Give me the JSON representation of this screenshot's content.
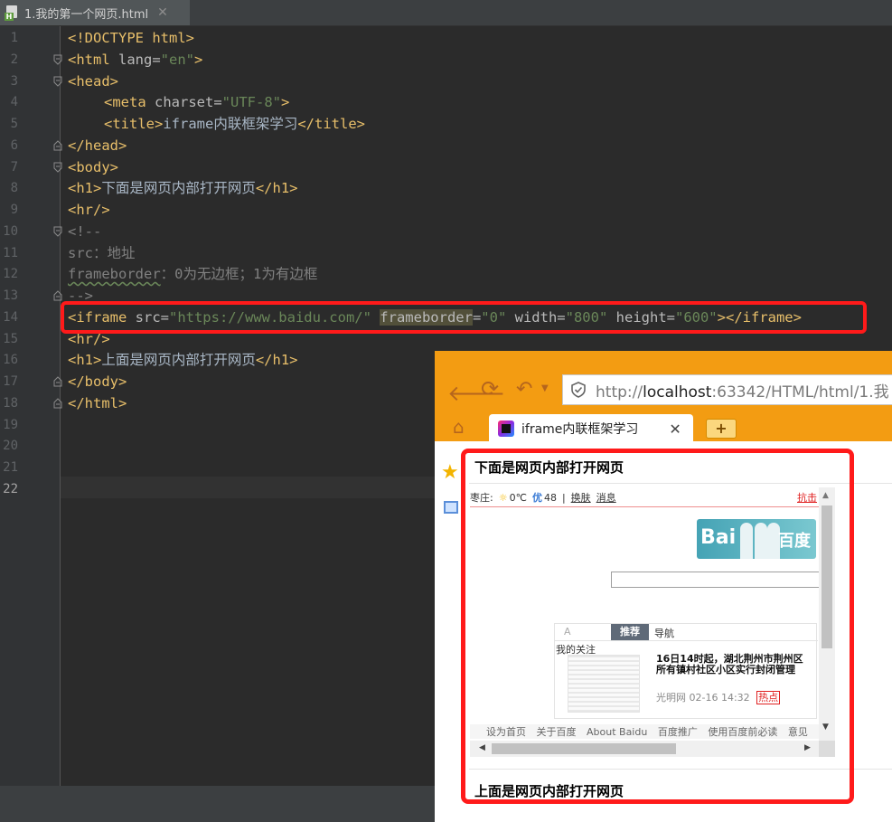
{
  "editor": {
    "tab": {
      "filename": "1.我的第一个网页.html",
      "icon": "html-file-icon",
      "close": "✕"
    },
    "current_line": 22,
    "line_numbers": [
      "1",
      "2",
      "3",
      "4",
      "5",
      "6",
      "7",
      "8",
      "9",
      "10",
      "11",
      "12",
      "13",
      "14",
      "15",
      "16",
      "17",
      "18",
      "19",
      "20",
      "21",
      "22"
    ],
    "code": {
      "l1": "<!DOCTYPE html>",
      "l2_open": "<html ",
      "l2_attr": "lang=",
      "l2_val": "\"en\"",
      "l2_close": ">",
      "l3": "<head>",
      "l4_open": "<meta ",
      "l4_attr": "charset=",
      "l4_val": "\"UTF-8\"",
      "l4_close": ">",
      "l5_open": "<title>",
      "l5_text": "iframe内联框架学习",
      "l5_close": "</title>",
      "l6": "</head>",
      "l7": "<body>",
      "l8_open": "<h1>",
      "l8_text": "下面是网页内部打开网页",
      "l8_close": "</h1>",
      "l9": "<hr/>",
      "l10": "<!--",
      "l11": "src：地址",
      "l12_a": "frameborder",
      "l12_b": "：0为无边框；1为有边框",
      "l13": "-->",
      "l14_open": "<iframe ",
      "l14_a1": "src=",
      "l14_v1": "\"https://www.baidu.com/\"",
      "l14_sp1": " ",
      "l14_a2": "frameborder",
      "l14_eq2": "=",
      "l14_v2": "\"0\"",
      "l14_sp2": " ",
      "l14_a3": "width=",
      "l14_v3": "\"800\"",
      "l14_sp3": " ",
      "l14_a4": "height=",
      "l14_v4": "\"600\"",
      "l14_close": "></iframe>",
      "l15": "<hr/>",
      "l16_open": "<h1>",
      "l16_text": "上面是网页内部打开网页",
      "l16_close": "</h1>",
      "l17": "</body>",
      "l18": "</html>"
    }
  },
  "browser": {
    "url_prefix": "http://",
    "url_host": "localhost",
    "url_rest": ":63342/HTML/html/1.我",
    "tab_title": "iframe内联框架学习",
    "tab_close": "✕",
    "new_tab": "+",
    "heading_top": "下面是网页内部打开网页",
    "heading_bottom": "上面是网页内部打开网页",
    "iframe": {
      "city": "枣庄:",
      "temp": "0℃",
      "aqi_label": "优",
      "aqi_value": "48",
      "divider": "|",
      "skin": "换肤",
      "messages": "消息",
      "hot_cut": "抗击",
      "logo_text": "Bai",
      "logo_cn": "百度",
      "feed_tab_a": "A",
      "feed_tab_recommend": "推荐",
      "feed_tab_nav": "导航",
      "my_follow": "我的关注",
      "news_title": "16日14时起，湖北荆州市荆州区所有镇村社区小区实行封闭管理",
      "news_source": "光明网",
      "news_time": "02-16 14:32",
      "news_badge": "热点",
      "footer": [
        "设为首页",
        "关于百度",
        "About Baidu",
        "百度推广",
        "使用百度前必读",
        "意见"
      ]
    }
  }
}
